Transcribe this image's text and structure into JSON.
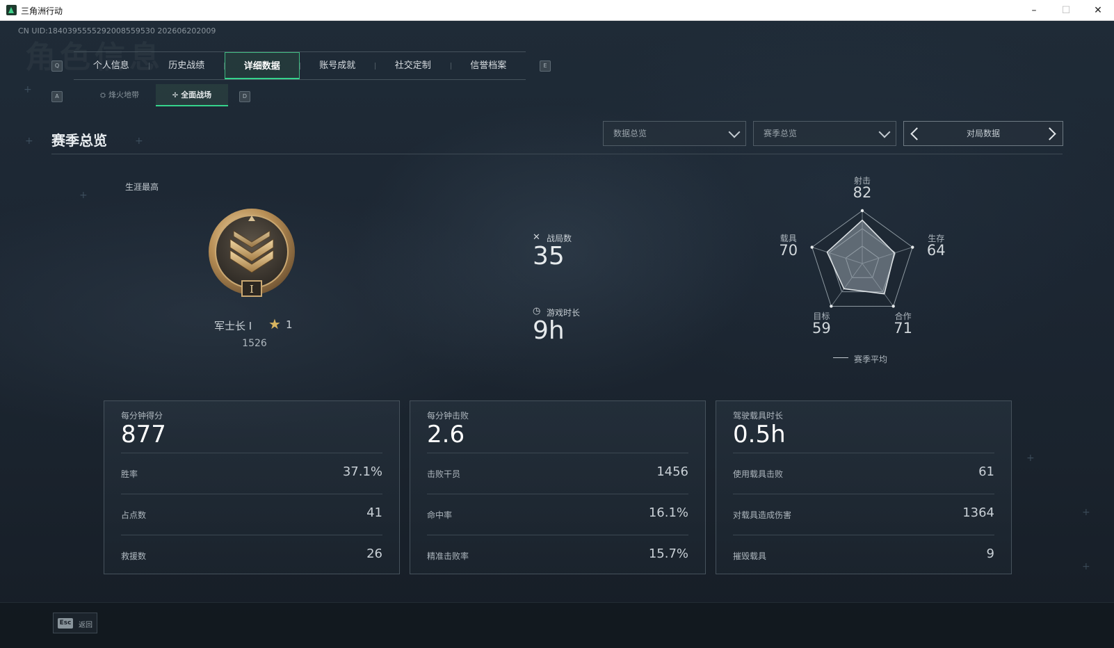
{
  "window": {
    "title": "三角洲行动",
    "min": "–",
    "max": "☐",
    "close": "✕"
  },
  "uid": "CN UID:1840395555292008559530 202606202009",
  "ghost_title": "角色信息",
  "tabs": {
    "prev_key": "Q",
    "next_key": "E",
    "items": [
      "个人信息",
      "历史战绩",
      "详细数据",
      "账号成就",
      "社交定制",
      "信誉档案"
    ],
    "active": "详细数据"
  },
  "subtabs": {
    "prev_key": "A",
    "next_key": "D",
    "items": [
      {
        "icon": "⛭",
        "label": "烽火地带"
      },
      {
        "icon": "✢",
        "label": "全面战场"
      }
    ],
    "active": "全面战场"
  },
  "section": {
    "title": "赛季总览",
    "dropdown1": "数据总览",
    "dropdown2": "赛季总览",
    "pager_label": "对局数据"
  },
  "rank": {
    "career_label": "生涯最高",
    "name": "军士长 I",
    "stars": "1",
    "score": "1526",
    "emblem_numeral": "I"
  },
  "center_stats": {
    "matches_label": "战局数",
    "matches_value": "35",
    "playtime_label": "游戏时长",
    "playtime_value": "9h"
  },
  "radar": {
    "axes": [
      {
        "label": "射击",
        "value": 82
      },
      {
        "label": "生存",
        "value": 64
      },
      {
        "label": "合作",
        "value": 71
      },
      {
        "label": "目标",
        "value": 59
      },
      {
        "label": "载具",
        "value": 70
      }
    ],
    "legend": "赛季平均"
  },
  "cards": [
    {
      "title": "每分钟得分",
      "value": "877",
      "rows": [
        {
          "label": "胜率",
          "value": "37.1%"
        },
        {
          "label": "占点数",
          "value": "41"
        },
        {
          "label": "救援数",
          "value": "26"
        }
      ]
    },
    {
      "title": "每分钟击败",
      "value": "2.6",
      "rows": [
        {
          "label": "击败干员",
          "value": "1456"
        },
        {
          "label": "命中率",
          "value": "16.1%"
        },
        {
          "label": "精准击败率",
          "value": "15.7%"
        }
      ]
    },
    {
      "title": "驾驶载具时长",
      "value": "0.5h",
      "rows": [
        {
          "label": "使用载具击败",
          "value": "61"
        },
        {
          "label": "对载具造成伤害",
          "value": "1364"
        },
        {
          "label": "摧毁载具",
          "value": "9"
        }
      ]
    }
  ],
  "footer": {
    "key": "Esc",
    "label": "返回"
  },
  "colors": {
    "accent": "#35d48c",
    "rank_star": "#d8b560"
  }
}
